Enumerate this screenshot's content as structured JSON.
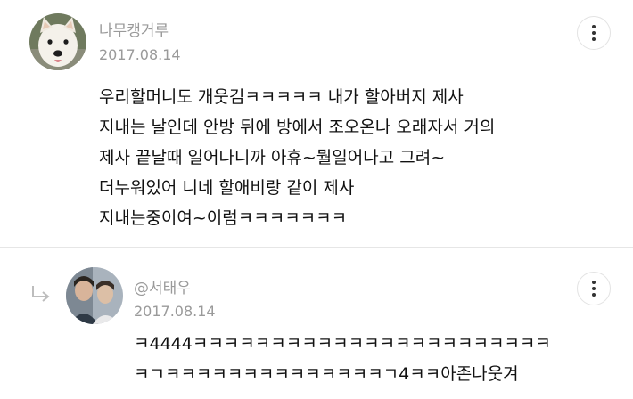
{
  "comments": [
    {
      "author": "나무캥거루",
      "date": "2017.08.14",
      "avatar": "white-dog-avatar",
      "lines": [
        "우리할머니도 개웃김ㅋㅋㅋㅋㅋ 내가 할아버지 제사",
        "지내는 날인데 안방 뒤에 방에서 조오온나 오래자서 거의",
        "제사 끝날때 일어나니까 아휴~뭘일어나고 그려~",
        "더누워있어 니네 할애비랑 같이 제사",
        "지내는중이여~이럼ㅋㅋㅋㅋㅋㅋㅋ"
      ]
    },
    {
      "author": "@서태우",
      "date": "2017.08.14",
      "avatar": "person-avatar",
      "reply_icon": "reply-arrow-icon",
      "lines": [
        "ㅋ4444ㅋㅋㅋㅋㅋㅋㅋㅋㅋㅋㅋㅋㅋㅋㅋㅋㅋㅋㅋㅋㅋㅋㅋ",
        "ㅋㄱㅋㅋㅋㅋㅋㅋㅋㅋㅋㅋㅋㅋㅋㅋㄱ4ㅋㅋ아존나웃겨"
      ]
    }
  ],
  "more_icon": "more-vertical-icon"
}
